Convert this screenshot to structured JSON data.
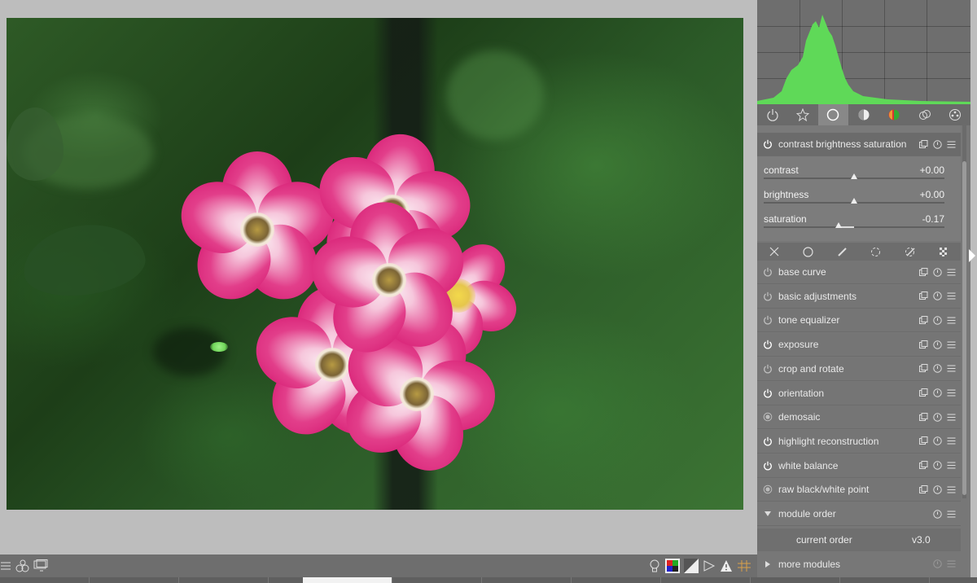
{
  "module_group_tabs": [
    {
      "name": "active-modules",
      "icon": "power-icon"
    },
    {
      "name": "favorites",
      "icon": "star-icon"
    },
    {
      "name": "technical",
      "icon": "circle-icon",
      "active": true
    },
    {
      "name": "grading",
      "icon": "half-circle-icon"
    },
    {
      "name": "color",
      "icon": "color-sphere-icon"
    },
    {
      "name": "correct",
      "icon": "correction-icon"
    },
    {
      "name": "effects",
      "icon": "effects-icon"
    }
  ],
  "expanded_module": {
    "label": "contrast brightness saturation",
    "sliders": [
      {
        "label": "contrast",
        "value_text": "+0.00",
        "value": 0.0
      },
      {
        "label": "brightness",
        "value_text": "+0.00",
        "value": 0.0
      },
      {
        "label": "saturation",
        "value_text": "-0.17",
        "value": -0.17
      }
    ]
  },
  "mask_tabs": [
    "off-icon",
    "uniform-icon",
    "drawn-icon",
    "parametric-icon",
    "drawn-parametric-icon",
    "raster-icon"
  ],
  "modules": [
    {
      "label": "base curve",
      "enabled": false,
      "always_on": false
    },
    {
      "label": "basic adjustments",
      "enabled": false,
      "always_on": false
    },
    {
      "label": "tone equalizer",
      "enabled": false,
      "always_on": false
    },
    {
      "label": "exposure",
      "enabled": true,
      "always_on": false
    },
    {
      "label": "crop and rotate",
      "enabled": false,
      "always_on": false
    },
    {
      "label": "orientation",
      "enabled": true,
      "always_on": false
    },
    {
      "label": "demosaic",
      "enabled": true,
      "always_on": true
    },
    {
      "label": "highlight reconstruction",
      "enabled": true,
      "always_on": false
    },
    {
      "label": "white balance",
      "enabled": true,
      "always_on": false
    },
    {
      "label": "raw black/white point",
      "enabled": true,
      "always_on": true
    }
  ],
  "module_order": {
    "label": "module order",
    "current_label": "current order",
    "current_value": "v3.0"
  },
  "more_modules": {
    "label": "more modules"
  },
  "colors": {
    "histogram_fill": "#5fd958",
    "panel_bg": "#777777",
    "active_tab": "#888888"
  }
}
